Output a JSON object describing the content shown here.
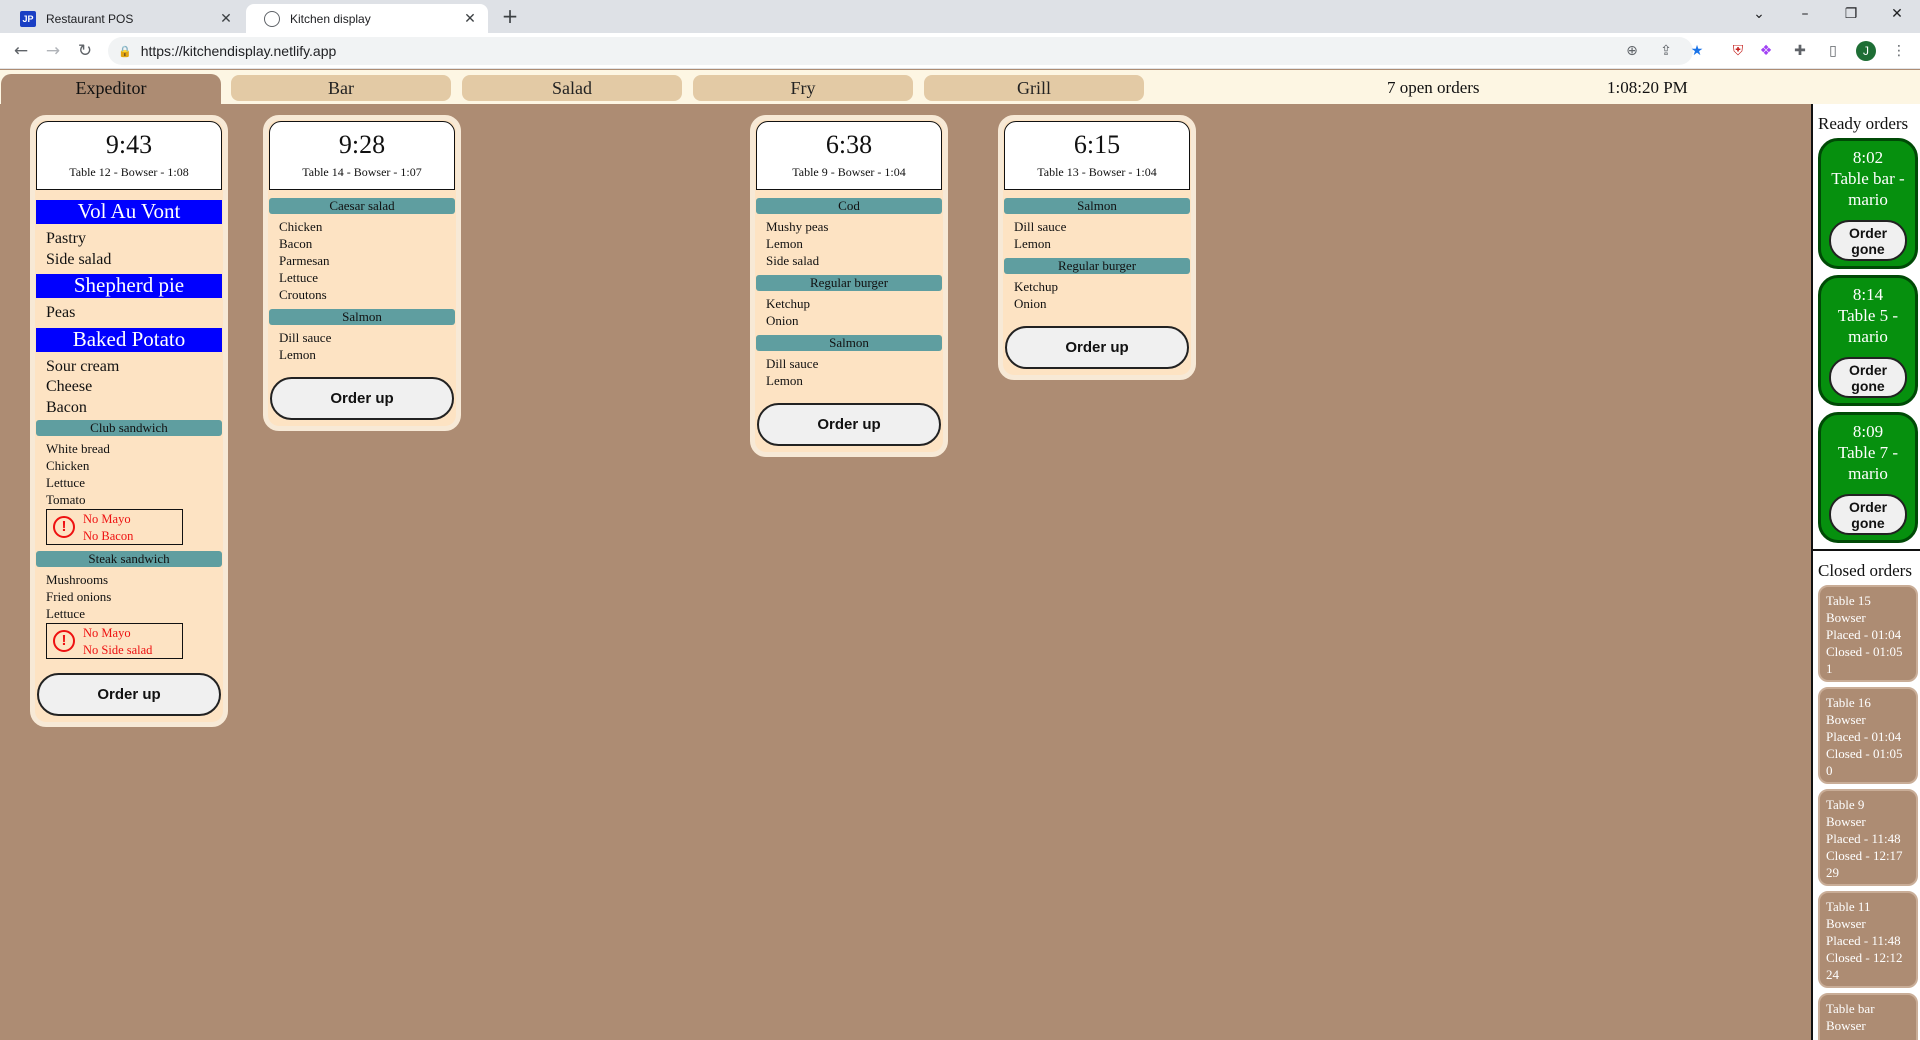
{
  "browser": {
    "tabs": [
      {
        "title": "Restaurant POS",
        "favicon": "jp-icon"
      },
      {
        "title": "Kitchen display",
        "favicon": "globe-icon"
      }
    ],
    "url": "https://kitchendisplay.netlify.app",
    "profile_initial": "J"
  },
  "nav": {
    "stations": [
      "Expeditor",
      "Bar",
      "Salad",
      "Fry",
      "Grill"
    ],
    "active_station": "Expeditor",
    "open_orders": "7 open orders",
    "clock": "1:08:20 PM"
  },
  "orders": [
    {
      "time": "9:43",
      "info": "Table 12 - Bowser - 1:08",
      "button": "Order up",
      "big_items": [
        {
          "name": "Vol Au Vont",
          "mods": [
            "Pastry",
            "Side salad"
          ]
        },
        {
          "name": "Shepherd pie",
          "mods": [
            "Peas"
          ]
        },
        {
          "name": "Baked Potato",
          "mods": [
            "Sour cream",
            "Cheese",
            "Bacon"
          ]
        }
      ],
      "items": [
        {
          "name": "Club sandwich",
          "mods": [
            "White bread",
            "Chicken",
            "Lettuce",
            "Tomato"
          ],
          "note": [
            "No Mayo",
            "No Bacon"
          ]
        },
        {
          "name": "Steak sandwich",
          "mods": [
            "Mushrooms",
            "Fried onions",
            "Lettuce"
          ],
          "note": [
            "No Mayo",
            "No Side salad"
          ]
        }
      ]
    },
    {
      "time": "9:28",
      "info": "Table 14 - Bowser - 1:07",
      "button": "Order up",
      "items": [
        {
          "name": "Caesar salad",
          "mods": [
            "Chicken",
            "Bacon",
            "Parmesan",
            "Lettuce",
            "Croutons"
          ]
        },
        {
          "name": "Salmon",
          "mods": [
            "Dill sauce",
            "Lemon"
          ]
        }
      ]
    },
    {
      "time": "6:38",
      "info": "Table 9 - Bowser - 1:04",
      "button": "Order up",
      "items": [
        {
          "name": "Cod",
          "mods": [
            "Mushy peas",
            "Lemon",
            "Side salad"
          ]
        },
        {
          "name": "Regular burger",
          "mods": [
            "Ketchup",
            "Onion"
          ]
        },
        {
          "name": "Salmon",
          "mods": [
            "Dill sauce",
            "Lemon"
          ]
        }
      ]
    },
    {
      "time": "6:15",
      "info": "Table 13 - Bowser - 1:04",
      "button": "Order up",
      "items": [
        {
          "name": "Salmon",
          "mods": [
            "Dill sauce",
            "Lemon"
          ]
        },
        {
          "name": "Regular burger",
          "mods": [
            "Ketchup",
            "Onion"
          ]
        }
      ]
    }
  ],
  "ready": {
    "title": "Ready orders",
    "orders": [
      {
        "time": "8:02",
        "label": "Table bar - mario",
        "button": "Order gone"
      },
      {
        "time": "8:14",
        "label": "Table 5 - mario",
        "button": "Order gone"
      },
      {
        "time": "8:09",
        "label": "Table 7 - mario",
        "button": "Order gone"
      }
    ]
  },
  "closed": {
    "title": "Closed orders",
    "orders": [
      {
        "table": "Table 15",
        "server": "Bowser",
        "placed": "Placed - 01:04",
        "closed": "Closed - 01:05",
        "duration": "1"
      },
      {
        "table": "Table 16",
        "server": "Bowser",
        "placed": "Placed - 01:04",
        "closed": "Closed - 01:05",
        "duration": "0"
      },
      {
        "table": "Table 9",
        "server": "Bowser",
        "placed": "Placed - 11:48",
        "closed": "Closed - 12:17",
        "duration": "29"
      },
      {
        "table": "Table 11",
        "server": "Bowser",
        "placed": "Placed - 11:48",
        "closed": "Closed - 12:12",
        "duration": "24"
      },
      {
        "table": "Table bar",
        "server": "Bowser",
        "placed": "",
        "closed": "",
        "duration": ""
      }
    ]
  },
  "colors": {
    "background": "#ad8c73",
    "card": "#fde3c3",
    "big_item": "#0000ff",
    "item_header": "#5f9ea0",
    "ready": "#06900e",
    "warning": "#e11111"
  }
}
